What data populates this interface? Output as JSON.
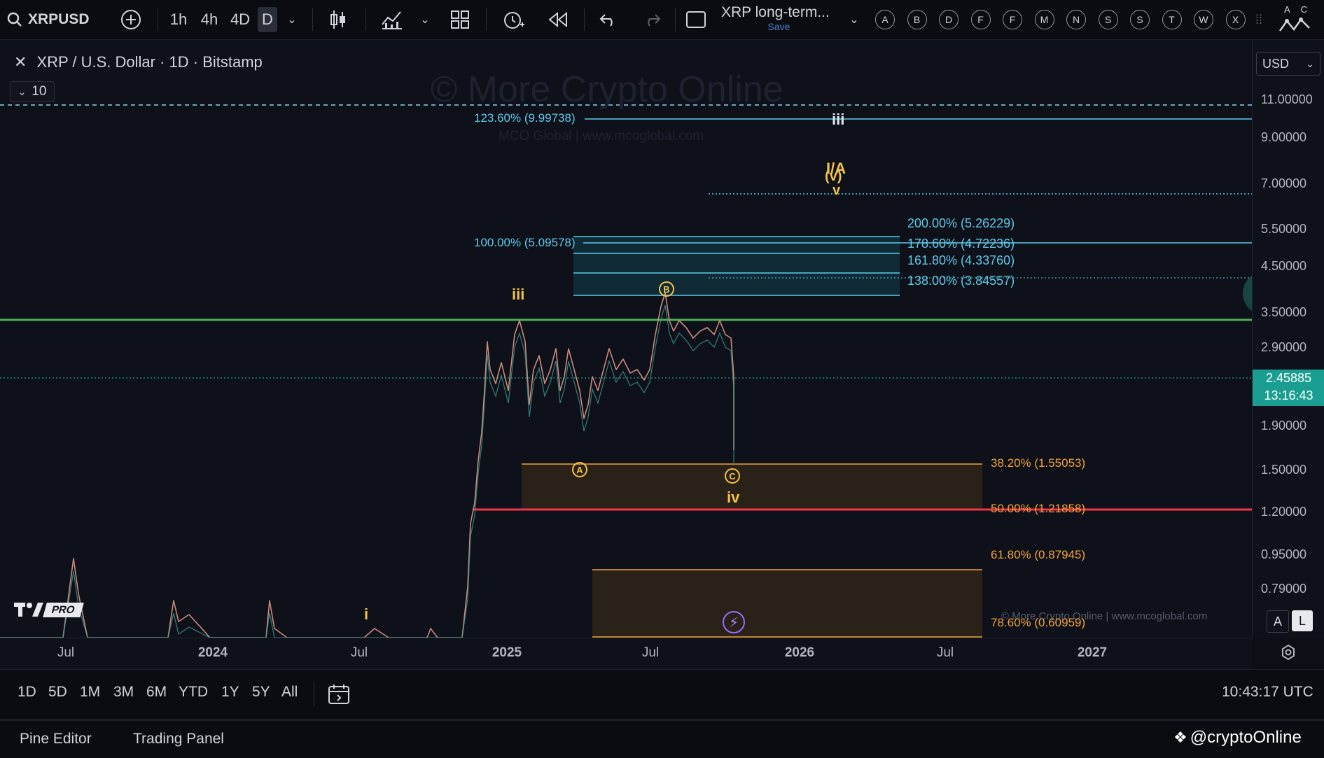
{
  "toolbar": {
    "symbol": "XRPUSD",
    "intervals": [
      "1h",
      "4h",
      "4D",
      "D"
    ],
    "active_interval": "D",
    "layout_name": "XRP long-term...",
    "save_label": "Save",
    "alpha_buttons": [
      "A",
      "B",
      "D",
      "F",
      "F",
      "M",
      "N",
      "S",
      "S",
      "T",
      "W",
      "X"
    ],
    "corner_letters": "A C"
  },
  "chart": {
    "title": "XRP / U.S. Dollar · 1D · Bitstamp",
    "indicator_count": "10",
    "watermark": "© More Crypto Online",
    "watermark_sub": "MCO Global  |  www.mcoglobal.com",
    "watermark_bottom": "© More Crypto Online  |  www.mcoglobal.com",
    "logo_label": "PRO",
    "currency": "USD",
    "current_price": "2.45885",
    "countdown": "13:16:43",
    "colors": {
      "background": "#0f111a",
      "support_line": "#4caf50",
      "red_line": "#f23645",
      "fib_cyan": "#5ecbe8",
      "fib_orange": "#f0a23c",
      "wave_label": "#f3c34a",
      "price_badge": "#1a9e92"
    }
  },
  "fib_levels_upper": [
    {
      "label": "123.60% (9.99738)"
    },
    {
      "label": "100.00% (5.09578)"
    },
    {
      "label": "200.00% (5.26229)"
    },
    {
      "label": "178.60% (4.72236)"
    },
    {
      "label": "161.80% (4.33760)"
    },
    {
      "label": "138.00% (3.84557)"
    }
  ],
  "fib_levels_lower": [
    {
      "label": "38.20% (1.55053)"
    },
    {
      "label": "50.00% (1.21858)"
    },
    {
      "label": "61.80% (0.87945)"
    },
    {
      "label": "78.60% (0.60959)"
    }
  ],
  "waves": {
    "iii_top": "iii",
    "iii_left": "iii",
    "iv": "iv",
    "i": "i",
    "i_a": "I/A",
    "v_paren": "(v)",
    "v": "v",
    "a": "A",
    "b": "B",
    "c": "C"
  },
  "price_axis": [
    "11.00000",
    "9.00000",
    "7.00000",
    "5.50000",
    "4.50000",
    "3.50000",
    "2.90000",
    "1.90000",
    "1.50000",
    "1.20000",
    "0.95000",
    "0.79000"
  ],
  "time_axis": [
    "Jul",
    "2024",
    "Jul",
    "2025",
    "Jul",
    "2026",
    "Jul",
    "2027"
  ],
  "scale_buttons": [
    "A",
    "L"
  ],
  "range_bar": {
    "ranges": [
      "1D",
      "5D",
      "1M",
      "3M",
      "6M",
      "YTD",
      "1Y",
      "5Y",
      "All"
    ],
    "clock": "10:43:17 UTC"
  },
  "bottom_bar": {
    "pine_editor": "Pine Editor",
    "trading_panel": "Trading Panel",
    "brand": "@cryptoOnline"
  }
}
